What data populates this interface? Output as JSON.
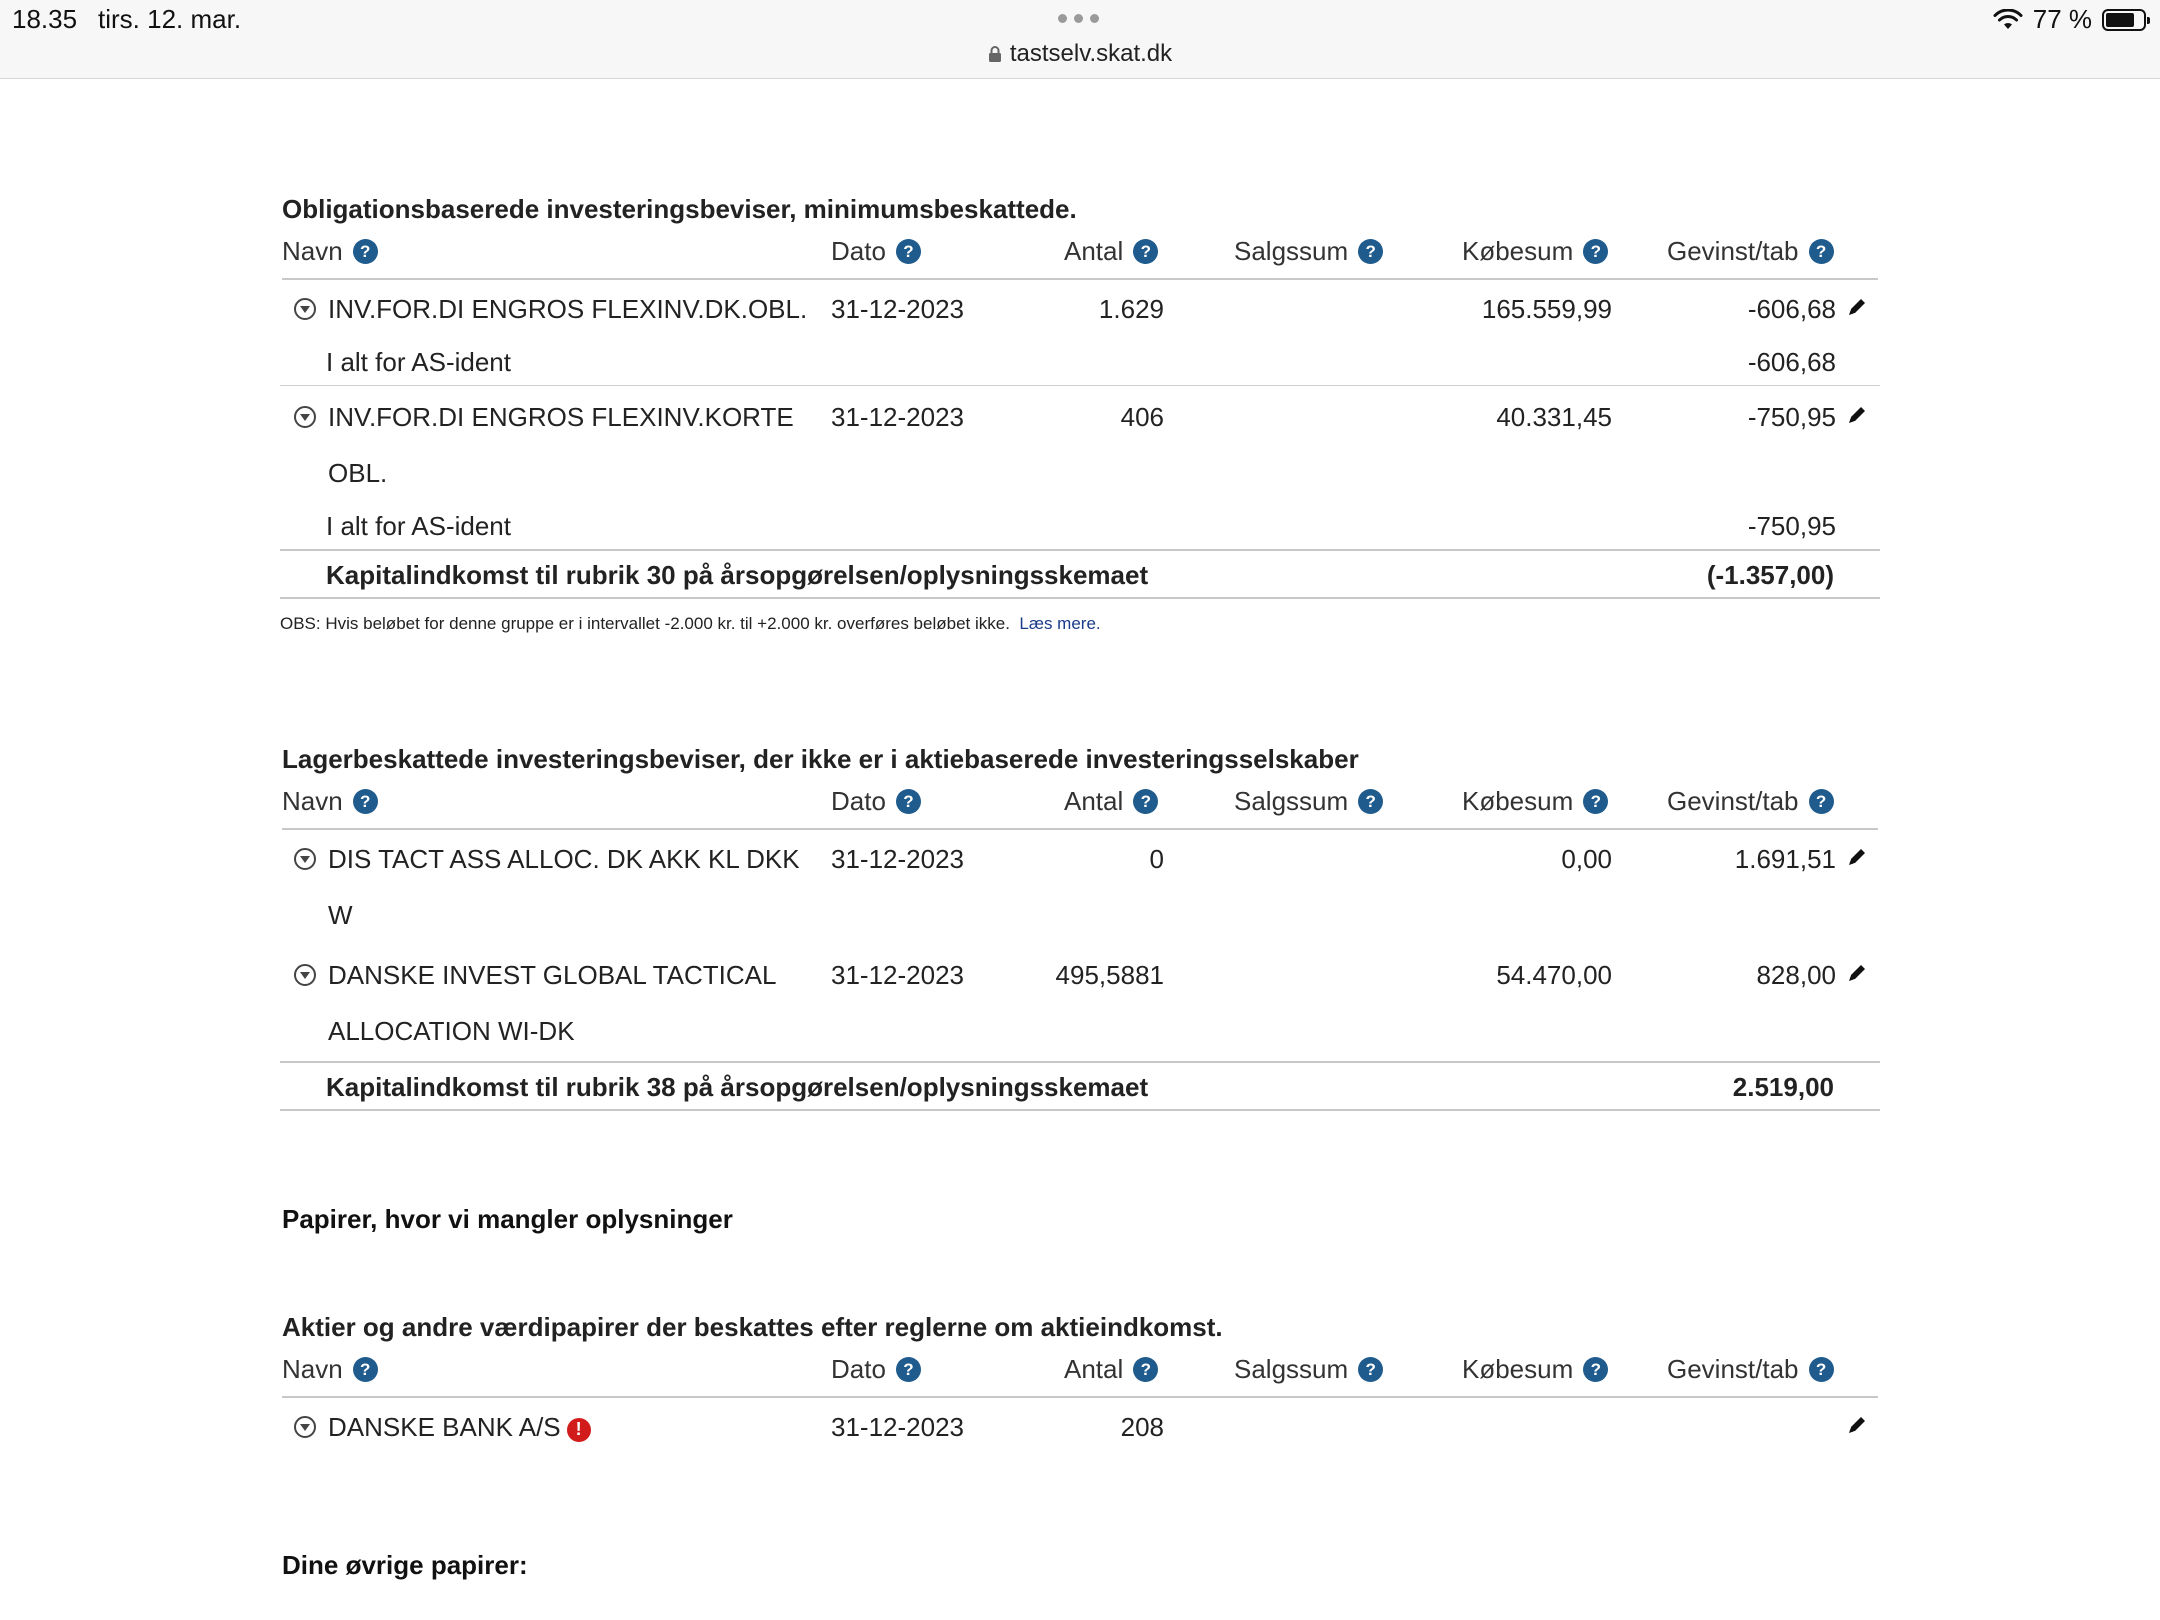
{
  "status_bar": {
    "time": "18.35",
    "date": "tirs. 12. mar.",
    "battery": "77 %",
    "battery_level": 0.77
  },
  "browser": {
    "url": "tastselv.skat.dk"
  },
  "columns": {
    "navn": "Navn",
    "dato": "Dato",
    "antal": "Antal",
    "salgssum": "Salgssum",
    "kobesum": "Købesum",
    "gevinst": "Gevinst/tab"
  },
  "section1": {
    "title": "Obligationsbaserede investeringsbeviser, minimumsbeskattede.",
    "rows": [
      {
        "name": "INV.FOR.DI ENGROS FLEXINV.DK.OBL.",
        "date": "31-12-2023",
        "antal": "1.629",
        "kobesum": "165.559,99",
        "gevinst": "-606,68",
        "subtotal_label": "I alt for AS-ident",
        "subtotal": "-606,68"
      },
      {
        "name": "INV.FOR.DI ENGROS FLEXINV.KORTE",
        "name2": "OBL.",
        "date": "31-12-2023",
        "antal": "406",
        "kobesum": "40.331,45",
        "gevinst": "-750,95",
        "subtotal_label": "I alt for AS-ident",
        "subtotal": "-750,95"
      }
    ],
    "total_label": "Kapitalindkomst til rubrik 30 på årsopgørelsen/oplysningsskemaet",
    "total": "(-1.357,00)",
    "obs": "OBS: Hvis beløbet for denne gruppe er i intervallet -2.000 kr. til +2.000 kr. overføres beløbet ikke.",
    "obs_link": "Læs mere."
  },
  "section2": {
    "title": "Lagerbeskattede investeringsbeviser, der ikke er i aktiebaserede investeringsselskaber",
    "rows": [
      {
        "name": "DIS TACT ASS ALLOC. DK AKK KL DKK",
        "name2": "W",
        "date": "31-12-2023",
        "antal": "0",
        "kobesum": "0,00",
        "gevinst": "1.691,51"
      },
      {
        "name": "DANSKE INVEST GLOBAL TACTICAL",
        "name2": "ALLOCATION WI-DK",
        "date": "31-12-2023",
        "antal": "495,5881",
        "kobesum": "54.470,00",
        "gevinst": "828,00"
      }
    ],
    "total_label": "Kapitalindkomst til rubrik 38 på årsopgørelsen/oplysningsskemaet",
    "total": "2.519,00"
  },
  "section3": {
    "title": "Papirer, hvor vi mangler oplysninger"
  },
  "section4": {
    "title": "Aktier og andre værdipapirer der beskattes efter reglerne om aktieindkomst.",
    "rows": [
      {
        "name": "DANSKE BANK A/S",
        "date": "31-12-2023",
        "antal": "208"
      }
    ]
  },
  "section5": {
    "title": "Dine øvrige papirer:"
  }
}
